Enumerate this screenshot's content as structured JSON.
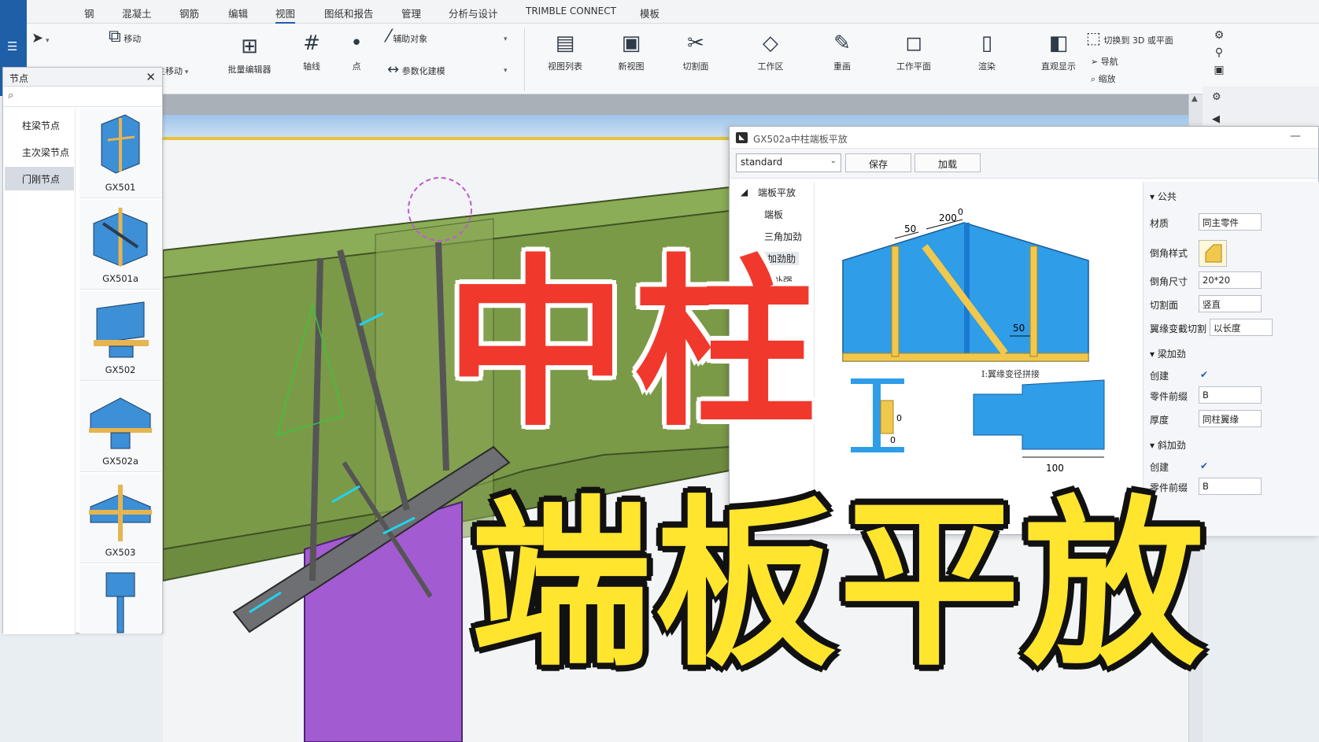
{
  "menu": {
    "items": [
      "钢",
      "混凝土",
      "钢筋",
      "编辑",
      "视图",
      "图纸和报告",
      "管理",
      "分析与设计",
      "TRIMBLE CONNECT",
      "模板"
    ],
    "active": "视图"
  },
  "ribbon": {
    "move": "移动",
    "move2": "主移动",
    "batch_editor": "批量编辑器",
    "axis": "轴线",
    "point": "点",
    "aux_object": "辅助对象",
    "param_modeling": "参数化建模",
    "view_list": "视图列表",
    "new_view": "新视图",
    "cut_plane": "切割面",
    "work_area": "工作区",
    "redraw": "重画",
    "work_plane": "工作平面",
    "render": "渲染",
    "visual_display": "直观显示",
    "switch_3d": "切换到 3D 或平面",
    "navigate": "导航",
    "zoom": "缩放"
  },
  "node_panel": {
    "title": "节点",
    "categories": [
      "柱梁节点",
      "主次梁节点",
      "门刚节点"
    ],
    "selected_category": "门刚节点",
    "thumbnails": [
      "GX501",
      "GX501a",
      "GX502",
      "GX502a",
      "GX503",
      ""
    ]
  },
  "dialog": {
    "title": "GX502a中柱端板平放",
    "preset": "standard",
    "save": "保存",
    "load": "加载",
    "tree": {
      "root": "端板平放",
      "children": [
        "端板",
        "三角加劲",
        "加劲肋",
        "板补强"
      ]
    },
    "drawing": {
      "dims": [
        "50",
        "200",
        "0",
        "50",
        "0",
        "0",
        "100"
      ],
      "caption": "I:翼缘变径拼接"
    },
    "props": {
      "section_common": "公共",
      "material_label": "材质",
      "material_value": "同主零件",
      "chamfer_style_label": "倒角样式",
      "chamfer_size_label": "倒角尺寸",
      "chamfer_size_value": "20*20",
      "cut_plane_label": "切割面",
      "cut_plane_value": "竖直",
      "flange_cut_label": "翼缘变截切割",
      "flange_cut_value": "以长度",
      "section_beam_stiff": "梁加劲",
      "create_label": "创建",
      "prefix_label": "零件前缀",
      "prefix_value": "B",
      "thickness_label": "厚度",
      "thickness_value": "同柱翼缘",
      "section_diag_stiff": "斜加劲",
      "create_label2": "创建",
      "prefix_label2": "零件前缀",
      "prefix_value2": "B"
    }
  },
  "overlay": {
    "title_red": "中柱",
    "title_yellow": "端板平放"
  },
  "colors": {
    "accent": "#1d5fb0",
    "steel_green": "#7a9a4a",
    "column_purple": "#a35bd1",
    "drawing_blue": "#2f9de8",
    "drawing_yellow": "#f1c84b",
    "title_red": "#f0392c",
    "title_yellow": "#ffe52e"
  }
}
